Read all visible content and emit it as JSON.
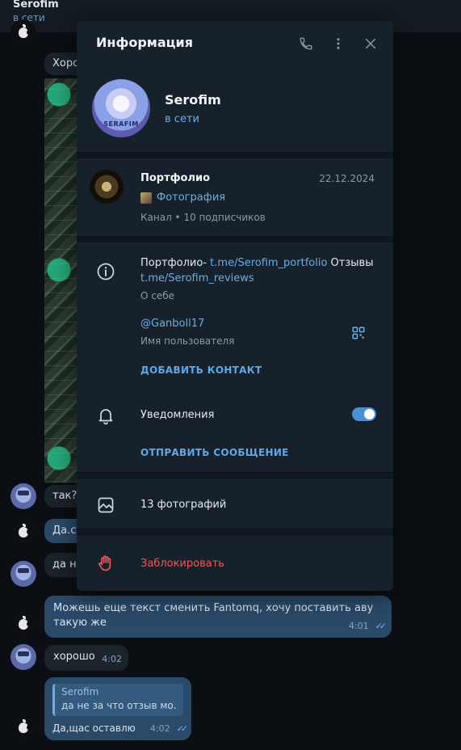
{
  "chat": {
    "name": "Serofim",
    "status": "в сети",
    "messages": [
      {
        "text": "Хоро"
      },
      {
        "text": "так?"
      },
      {
        "text": "Да.ст"
      },
      {
        "text": "да не"
      },
      {
        "text": "Можешь еще текст сменить Fantomq, хочу поставить аву такую же",
        "time": "4:01"
      },
      {
        "text": "хорошо",
        "time": "4:02"
      },
      {
        "reply_author": "Serofim",
        "reply_text": "да не за что отзыв мо...",
        "text": "Да,щас оставлю",
        "time": "4:02"
      }
    ]
  },
  "panel": {
    "title": "Информация",
    "profile": {
      "name": "Serofim",
      "status": "в сети",
      "avatar_text": "SERAFIM"
    },
    "channel": {
      "title": "Портфолио",
      "date": "22.12.2024",
      "last_message": "Фотография",
      "subtitle": "Канал • 10 подписчиков"
    },
    "bio": {
      "prefix": "Портфолио- ",
      "link1": "t.me/Serofim_portfolio",
      "middle": " Отзывы ",
      "link2": "t.me/Serofim_reviews",
      "label": "О себе"
    },
    "username": {
      "value": "@Ganboll17",
      "label": "Имя пользователя"
    },
    "add_contact": "ДОБАВИТЬ КОНТАКТ",
    "notifications": {
      "label": "Уведомления",
      "enabled": true
    },
    "send_message": "ОТПРАВИТЬ СООБЩЕНИЕ",
    "photos": "13 фотографий",
    "block": "Заблокировать"
  },
  "colors": {
    "accent": "#6aaee4",
    "danger": "#e85a5a",
    "panel_bg": "#17212b"
  }
}
